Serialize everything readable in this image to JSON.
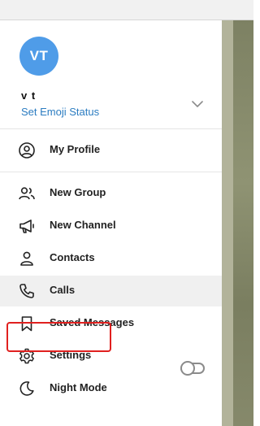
{
  "profile": {
    "avatar_initials": "VT",
    "name": "v t",
    "status_link": "Set Emoji Status",
    "avatar_color": "#4f9ce8",
    "link_color": "#2b7cc1"
  },
  "menu": {
    "my_profile": "My Profile",
    "new_group": "New Group",
    "new_channel": "New Channel",
    "contacts": "Contacts",
    "calls": "Calls",
    "saved_messages": "Saved Messages",
    "settings": "Settings",
    "night_mode": "Night Mode"
  },
  "night_mode_enabled": false,
  "highlight_color": "#e0201f"
}
